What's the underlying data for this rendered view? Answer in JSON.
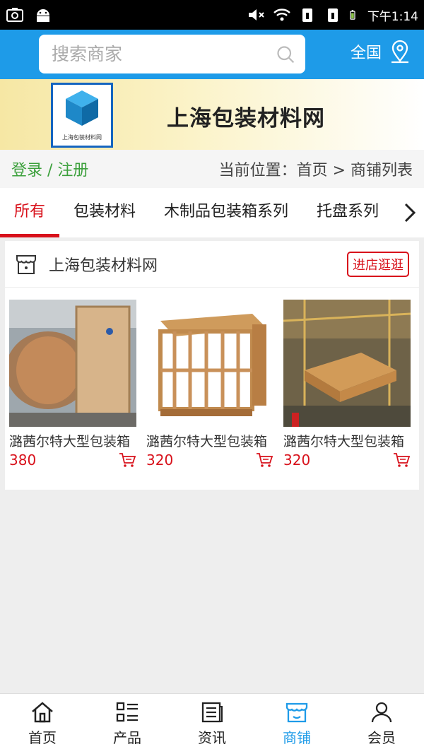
{
  "status_bar": {
    "time": "下午1:14"
  },
  "search": {
    "placeholder": "搜索商家",
    "region_label": "全国"
  },
  "banner": {
    "logo_caption": "上海包装材料网",
    "title": "上海包装材料网"
  },
  "breadcrumb": {
    "login_label": "登录 / 注册",
    "location_text": "当前位置：首页 > 商铺列表"
  },
  "tabs": [
    {
      "label": "所有",
      "active": true
    },
    {
      "label": "包装材料"
    },
    {
      "label": "木制品包装箱系列"
    },
    {
      "label": "托盘系列"
    }
  ],
  "shop": {
    "name": "上海包装材料网",
    "enter_label": "进店逛逛",
    "products": [
      {
        "name": "潞茜尔特大型包装箱",
        "price": "380"
      },
      {
        "name": "潞茜尔特大型包装箱",
        "price": "320"
      },
      {
        "name": "潞茜尔特大型包装箱",
        "price": "320"
      }
    ]
  },
  "bottom_nav": [
    {
      "label": "首页",
      "icon": "home-icon"
    },
    {
      "label": "产品",
      "icon": "grid-list-icon"
    },
    {
      "label": "资讯",
      "icon": "news-icon"
    },
    {
      "label": "商铺",
      "icon": "shop-icon",
      "active": true
    },
    {
      "label": "会员",
      "icon": "user-icon"
    }
  ],
  "colors": {
    "primary": "#1e9be8",
    "accent": "#d8111b",
    "login_green": "#3ca03c"
  }
}
